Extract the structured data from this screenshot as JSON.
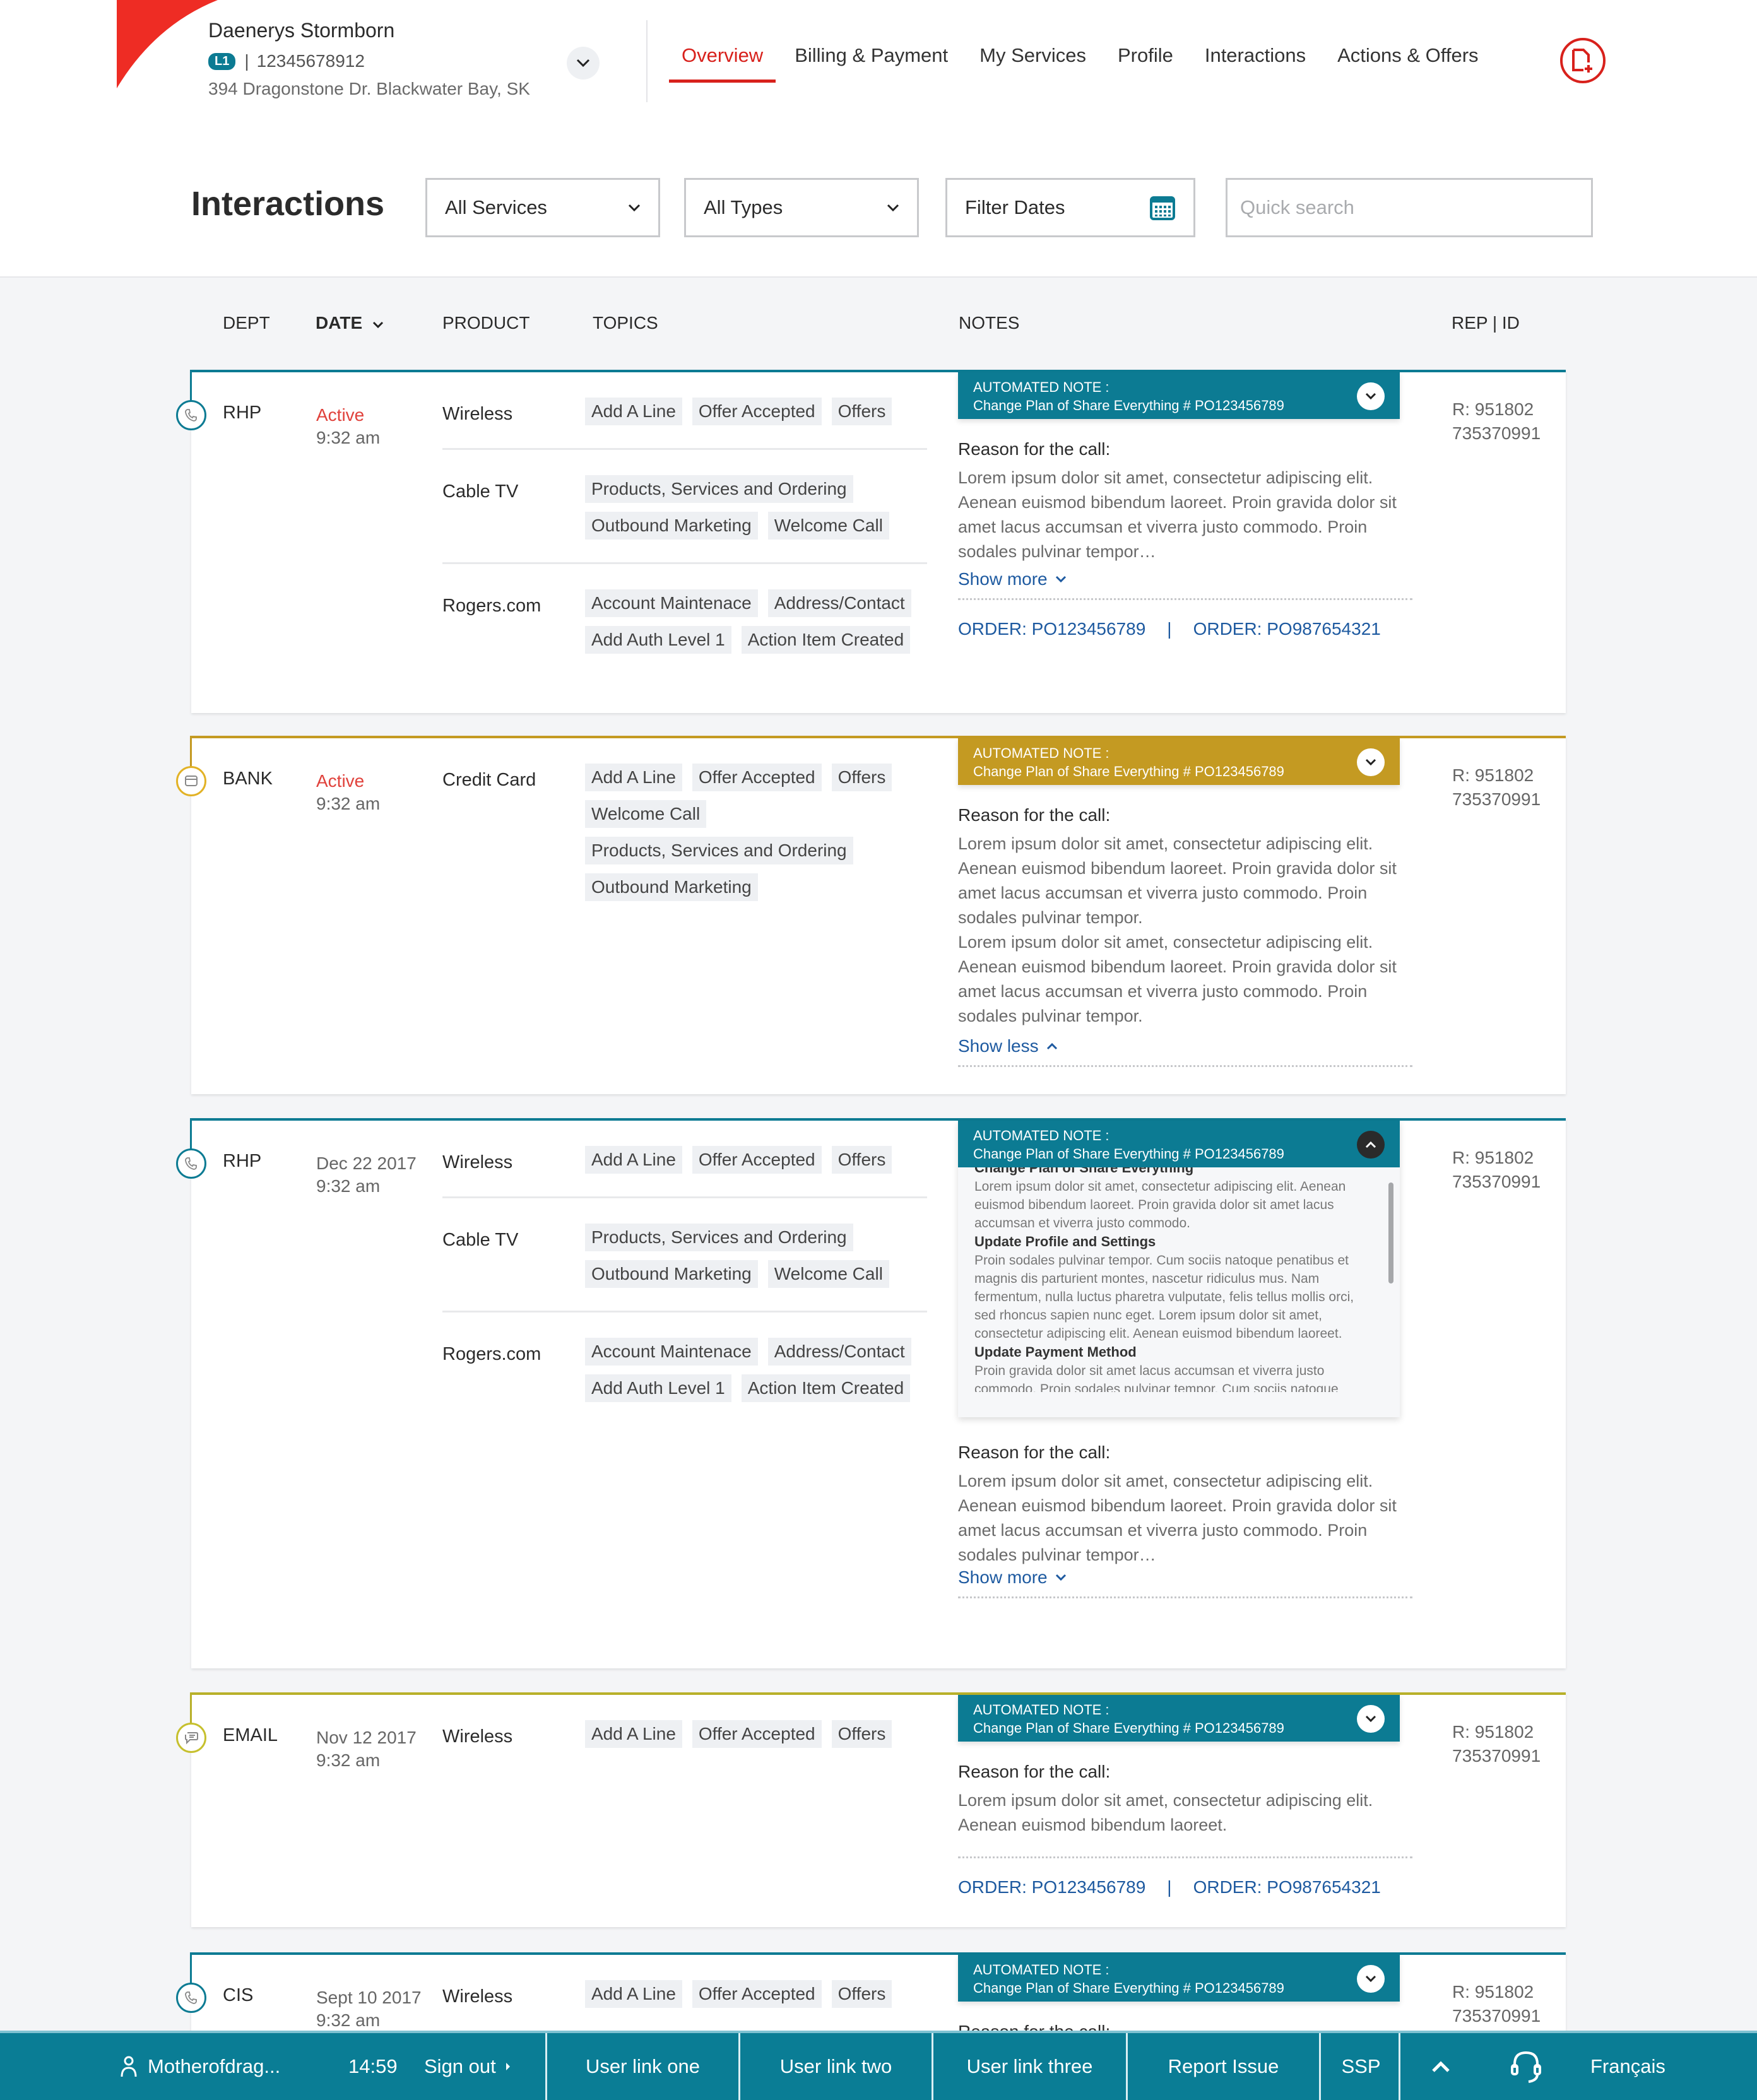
{
  "customer": {
    "name": "Daenerys Stormborn",
    "level_badge": "L1",
    "separator": "|",
    "account_number": "12345678912",
    "address": "394 Dragonstone Dr. Blackwater Bay, SK"
  },
  "nav": {
    "items": [
      {
        "label": "Overview",
        "active": true
      },
      {
        "label": "Billing & Payment",
        "active": false
      },
      {
        "label": "My Services",
        "active": false
      },
      {
        "label": "Profile",
        "active": false
      },
      {
        "label": "Interactions",
        "active": false
      },
      {
        "label": "Actions & Offers",
        "active": false
      }
    ],
    "new_document_icon": "document-plus-icon"
  },
  "page": {
    "title": "Interactions",
    "filters": {
      "services": "All Services",
      "types": "All Types",
      "dates": "Filter Dates",
      "search_placeholder": "Quick search",
      "search_value": ""
    }
  },
  "table": {
    "columns": {
      "dept": "DEPT",
      "date": "DATE",
      "product": "PRODUCT",
      "topics": "TOPICS",
      "notes": "NOTES",
      "rep": "REP | ID"
    },
    "sorted_by": "DATE",
    "sort_direction": "descending"
  },
  "colors": {
    "brand_red": "#d8211c",
    "teal": "#0c7b93",
    "gold": "#c49a22",
    "olive": "#b8b02a",
    "link_blue": "#1e5aa0",
    "active_red": "#e0413b"
  },
  "interactions": [
    {
      "dept": "RHP",
      "channel_icon": "phone-icon",
      "date": "Active",
      "time": "9:32 am",
      "products": [
        {
          "name": "Wireless",
          "topics": [
            "Add A Line",
            "Offer Accepted",
            "Offers"
          ]
        },
        {
          "name": "Cable TV",
          "topics": [
            "Products, Services and Ordering",
            "Outbound Marketing",
            "Welcome Call"
          ]
        },
        {
          "name": "Rogers.com",
          "topics": [
            "Account Maintenace",
            "Address/Contact",
            "Add Auth Level 1",
            "Action Item Created"
          ]
        }
      ],
      "automated_note": {
        "label": "AUTOMATED NOTE :",
        "description": "Change Plan of Share Everything # PO123456789",
        "expanded": false
      },
      "reason_title": "Reason for the call:",
      "reason_text": "Lorem ipsum dolor sit amet, consectetur adipiscing elit. Aenean euismod bibendum laoreet. Proin gravida dolor sit amet lacus accumsan et viverra justo commodo. Proin sodales pulvinar tempor…",
      "toggle_label": "Show more",
      "orders": [
        "ORDER: PO123456789",
        "ORDER: PO987654321"
      ],
      "rep": "R: 951802",
      "rep_id": "735370991"
    },
    {
      "dept": "BANK",
      "channel_icon": "card-icon",
      "date": "Active",
      "time": "9:32 am",
      "products": [
        {
          "name": "Credit Card",
          "topics": [
            "Add A Line",
            "Offer Accepted",
            "Offers",
            "Welcome Call",
            "Products, Services and Ordering",
            "Outbound Marketing"
          ]
        }
      ],
      "automated_note": {
        "label": "AUTOMATED NOTE :",
        "description": "Change Plan of Share Everything # PO123456789",
        "expanded": false
      },
      "reason_title": "Reason for the call:",
      "reason_paragraphs": [
        "Lorem ipsum dolor sit amet, consectetur adipiscing elit. Aenean euismod bibendum laoreet. Proin gravida dolor sit amet lacus accumsan et viverra justo commodo. Proin sodales pulvinar tempor.",
        "Lorem ipsum dolor sit amet, consectetur adipiscing elit. Aenean euismod bibendum laoreet. Proin gravida dolor sit amet lacus accumsan et viverra justo commodo. Proin sodales pulvinar tempor."
      ],
      "toggle_label": "Show less",
      "rep": "R: 951802",
      "rep_id": "735370991"
    },
    {
      "dept": "RHP",
      "channel_icon": "phone-icon",
      "date": "Dec 22 2017",
      "time": "9:32 am",
      "products": [
        {
          "name": "Wireless",
          "topics": [
            "Add A Line",
            "Offer Accepted",
            "Offers"
          ]
        },
        {
          "name": "Cable TV",
          "topics": [
            "Products, Services and Ordering",
            "Outbound Marketing",
            "Welcome Call"
          ]
        },
        {
          "name": "Rogers.com",
          "topics": [
            "Account Maintenace",
            "Address/Contact",
            "Add Auth Level 1",
            "Action Item Created"
          ]
        }
      ],
      "automated_note": {
        "label": "AUTOMATED NOTE :",
        "description": "Change Plan of Share Everything # PO123456789",
        "expanded": true,
        "sections": [
          {
            "heading": "Change Plan of Share Everything",
            "text": "Lorem ipsum dolor sit amet, consectetur adipiscing elit. Aenean euismod bibendum laoreet. Proin gravida dolor sit amet lacus accumsan et viverra justo commodo."
          },
          {
            "heading": "Update Profile and Settings",
            "text": "Proin sodales pulvinar tempor. Cum sociis natoque penatibus et magnis dis parturient montes, nascetur ridiculus mus. Nam fermentum, nulla luctus pharetra vulputate, felis tellus mollis orci, sed rhoncus sapien nunc eget. Lorem ipsum dolor sit amet, consectetur adipiscing elit. Aenean euismod bibendum laoreet."
          },
          {
            "heading": "Update Payment Method",
            "text": "Proin gravida dolor sit amet lacus accumsan et viverra justo commodo. Proin sodales pulvinar tempor. Cum sociis natoque mmodo. Proin sodales pulvinar tempor. Cum sociis"
          }
        ]
      },
      "reason_title": "Reason for the call:",
      "reason_text": "Lorem ipsum dolor sit amet, consectetur adipiscing elit. Aenean euismod bibendum laoreet. Proin gravida dolor sit amet lacus accumsan et viverra justo commodo. Proin sodales pulvinar tempor…",
      "toggle_label": "Show more",
      "rep": "R: 951802",
      "rep_id": "735370991"
    },
    {
      "dept": "EMAIL",
      "channel_icon": "chat-bubble-icon",
      "date": "Nov 12 2017",
      "time": "9:32 am",
      "products": [
        {
          "name": "Wireless",
          "topics": [
            "Add A Line",
            "Offer Accepted",
            "Offers"
          ]
        }
      ],
      "automated_note": {
        "label": "AUTOMATED NOTE :",
        "description": "Change Plan of Share Everything # PO123456789",
        "expanded": false
      },
      "reason_title": "Reason for the call:",
      "reason_text": "Lorem ipsum dolor sit amet, consectetur adipiscing elit. Aenean euismod bibendum laoreet.",
      "orders": [
        "ORDER: PO123456789",
        "ORDER: PO987654321"
      ],
      "rep": "R: 951802",
      "rep_id": "735370991"
    },
    {
      "dept": "CIS",
      "channel_icon": "phone-icon",
      "date": "Sept 10 2017",
      "time": "9:32 am",
      "products": [
        {
          "name": "Wireless",
          "topics": [
            "Add A Line",
            "Offer Accepted",
            "Offers"
          ]
        }
      ],
      "automated_note": {
        "label": "AUTOMATED NOTE :",
        "description": "Change Plan of Share Everything # PO123456789",
        "expanded": false
      },
      "reason_title": "Reason for the call:",
      "rep": "R: 951802",
      "rep_id": "735370991"
    }
  ],
  "footer": {
    "user": "Motherofdrag...",
    "session_time": "14:59",
    "sign_out": "Sign out",
    "links": [
      "User link one",
      "User link two",
      "User link three",
      "Report Issue",
      "SSP"
    ],
    "language": "Français"
  }
}
